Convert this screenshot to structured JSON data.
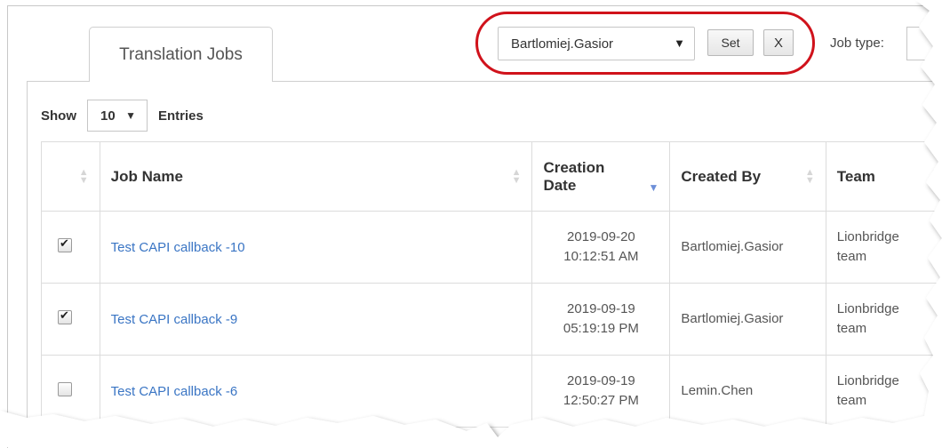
{
  "tabs": [
    {
      "label": "Translation Jobs"
    }
  ],
  "user_filter": {
    "value": "Bartlomiej.Gasior",
    "set_label": "Set",
    "clear_label": "X"
  },
  "job_type": {
    "label": "Job type:"
  },
  "entries": {
    "show_label": "Show",
    "value": "10",
    "entries_label": "Entries"
  },
  "table": {
    "headers": {
      "job_name": "Job Name",
      "creation_date_1": "Creation",
      "creation_date_2": "Date",
      "created_by": "Created By",
      "team": "Team"
    },
    "rows": [
      {
        "checked": true,
        "job_name": "Test CAPI callback -10",
        "date": "2019-09-20",
        "time": "10:12:51 AM",
        "created_by": "Bartlomiej.Gasior",
        "team_1": "Lionbridge",
        "team_2": "team"
      },
      {
        "checked": true,
        "job_name": "Test CAPI callback -9",
        "date": "2019-09-19",
        "time": "05:19:19 PM",
        "created_by": "Bartlomiej.Gasior",
        "team_1": "Lionbridge",
        "team_2": "team"
      },
      {
        "checked": false,
        "job_name": "Test CAPI callback -6",
        "date": "2019-09-19",
        "time": "12:50:27 PM",
        "created_by": "Lemin.Chen",
        "team_1": "Lionbridge",
        "team_2": "team"
      }
    ]
  },
  "colors": {
    "link": "#3a75c4",
    "highlight": "#d0121b",
    "sort_active": "#6d8fd8"
  },
  "icons": {
    "dropdown": "triangle-down",
    "sort": "up-down-arrows",
    "checkbox": "check"
  }
}
